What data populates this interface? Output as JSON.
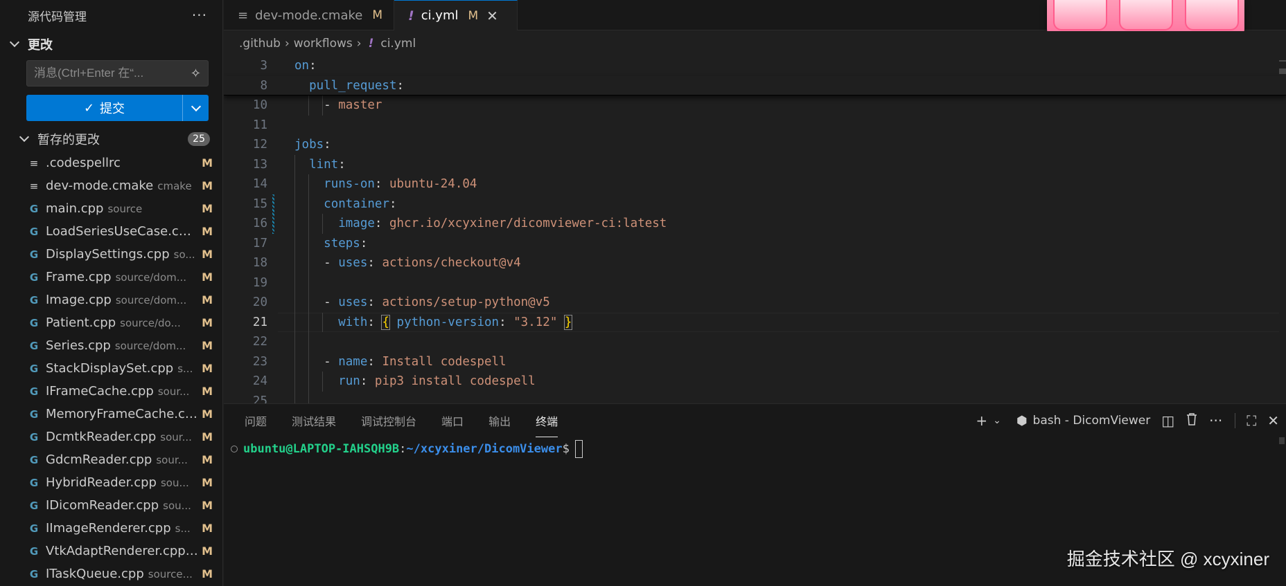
{
  "sidebar": {
    "title": "源代码管理",
    "more": "···",
    "section_title": "更改",
    "message_placeholder": "消息(Ctrl+Enter 在“...",
    "commit_label": "提交",
    "staged_label": "暂存的更改",
    "staged_count": "25",
    "files": [
      {
        "icon": "text-file-icon",
        "glyph": "≡",
        "name": ".codespellrc",
        "path": "",
        "status": "M"
      },
      {
        "icon": "text-file-icon",
        "glyph": "≡",
        "name": "dev-mode.cmake",
        "path": "cmake",
        "status": "M"
      },
      {
        "icon": "cpp-file-icon",
        "glyph": "G",
        "name": "main.cpp",
        "path": "source",
        "status": "M"
      },
      {
        "icon": "cpp-file-icon",
        "glyph": "G",
        "name": "LoadSeriesUseCase.cp...",
        "path": "",
        "status": "M"
      },
      {
        "icon": "cpp-file-icon",
        "glyph": "G",
        "name": "DisplaySettings.cpp",
        "path": "so...",
        "status": "M"
      },
      {
        "icon": "cpp-file-icon",
        "glyph": "G",
        "name": "Frame.cpp",
        "path": "source/dom...",
        "status": "M"
      },
      {
        "icon": "cpp-file-icon",
        "glyph": "G",
        "name": "Image.cpp",
        "path": "source/dom...",
        "status": "M"
      },
      {
        "icon": "cpp-file-icon",
        "glyph": "G",
        "name": "Patient.cpp",
        "path": "source/do...",
        "status": "M"
      },
      {
        "icon": "cpp-file-icon",
        "glyph": "G",
        "name": "Series.cpp",
        "path": "source/dom...",
        "status": "M"
      },
      {
        "icon": "cpp-file-icon",
        "glyph": "G",
        "name": "StackDisplaySet.cpp",
        "path": "s...",
        "status": "M"
      },
      {
        "icon": "cpp-file-icon",
        "glyph": "G",
        "name": "IFrameCache.cpp",
        "path": "sour...",
        "status": "M"
      },
      {
        "icon": "cpp-file-icon",
        "glyph": "G",
        "name": "MemoryFrameCache.c...",
        "path": "",
        "status": "M"
      },
      {
        "icon": "cpp-file-icon",
        "glyph": "G",
        "name": "DcmtkReader.cpp",
        "path": "sour...",
        "status": "M"
      },
      {
        "icon": "cpp-file-icon",
        "glyph": "G",
        "name": "GdcmReader.cpp",
        "path": "sour...",
        "status": "M"
      },
      {
        "icon": "cpp-file-icon",
        "glyph": "G",
        "name": "HybridReader.cpp",
        "path": "sou...",
        "status": "M"
      },
      {
        "icon": "cpp-file-icon",
        "glyph": "G",
        "name": "IDicomReader.cpp",
        "path": "sou...",
        "status": "M"
      },
      {
        "icon": "cpp-file-icon",
        "glyph": "G",
        "name": "IImageRenderer.cpp",
        "path": "s...",
        "status": "M"
      },
      {
        "icon": "cpp-file-icon",
        "glyph": "G",
        "name": "VtkAdaptRenderer.cpp...",
        "path": "",
        "status": "M"
      },
      {
        "icon": "cpp-file-icon",
        "glyph": "G",
        "name": "ITaskQueue.cpp",
        "path": "source...",
        "status": "M"
      }
    ]
  },
  "tabs": [
    {
      "name": "dev-mode.cmake",
      "status": "M",
      "icon": "≡",
      "active": false
    },
    {
      "name": "ci.yml",
      "status": "M",
      "icon": "!",
      "active": true,
      "close": "✕"
    }
  ],
  "breadcrumb": {
    "parts": [
      ".github",
      "workflows",
      "ci.yml"
    ],
    "sep": "›",
    "file_icon": "!"
  },
  "editor": {
    "lines": [
      {
        "n": "3",
        "tokens": [
          [
            "k",
            "on"
          ],
          [
            "p",
            ":"
          ]
        ]
      },
      {
        "n": "8",
        "tokens": [
          [
            "p",
            "  "
          ],
          [
            "k",
            "pull_request"
          ],
          [
            "p",
            ":"
          ]
        ]
      },
      {
        "n": "10",
        "tokens": [
          [
            "p",
            "    - "
          ],
          [
            "s",
            "master"
          ]
        ]
      },
      {
        "n": "11",
        "tokens": []
      },
      {
        "n": "12",
        "tokens": [
          [
            "k",
            "jobs"
          ],
          [
            "p",
            ":"
          ]
        ]
      },
      {
        "n": "13",
        "tokens": [
          [
            "p",
            "  "
          ],
          [
            "k",
            "lint"
          ],
          [
            "p",
            ":"
          ]
        ]
      },
      {
        "n": "14",
        "tokens": [
          [
            "p",
            "    "
          ],
          [
            "k",
            "runs-on"
          ],
          [
            "p",
            ": "
          ],
          [
            "s",
            "ubuntu-24.04"
          ]
        ]
      },
      {
        "n": "15",
        "tokens": [
          [
            "p",
            "    "
          ],
          [
            "k",
            "container"
          ],
          [
            "p",
            ":"
          ]
        ]
      },
      {
        "n": "16",
        "tokens": [
          [
            "p",
            "      "
          ],
          [
            "k",
            "image"
          ],
          [
            "p",
            ": "
          ],
          [
            "s",
            "ghcr.io/xcyxiner/dicomviewer-ci:latest"
          ]
        ]
      },
      {
        "n": "17",
        "tokens": [
          [
            "p",
            "    "
          ],
          [
            "k",
            "steps"
          ],
          [
            "p",
            ":"
          ]
        ]
      },
      {
        "n": "18",
        "tokens": [
          [
            "p",
            "    - "
          ],
          [
            "k",
            "uses"
          ],
          [
            "p",
            ": "
          ],
          [
            "s",
            "actions/checkout@v4"
          ]
        ]
      },
      {
        "n": "19",
        "tokens": []
      },
      {
        "n": "20",
        "tokens": [
          [
            "p",
            "    - "
          ],
          [
            "k",
            "uses"
          ],
          [
            "p",
            ": "
          ],
          [
            "s",
            "actions/setup-python@v5"
          ]
        ]
      },
      {
        "n": "21",
        "tokens": [
          [
            "p",
            "      "
          ],
          [
            "k",
            "with"
          ],
          [
            "p",
            ": "
          ],
          [
            "br",
            "{"
          ],
          [
            "p",
            " "
          ],
          [
            "k",
            "python-version"
          ],
          [
            "p",
            ": "
          ],
          [
            "s",
            "\"3.12\""
          ],
          [
            "p",
            " "
          ],
          [
            "br",
            "}"
          ]
        ]
      },
      {
        "n": "22",
        "tokens": []
      },
      {
        "n": "23",
        "tokens": [
          [
            "p",
            "    - "
          ],
          [
            "k",
            "name"
          ],
          [
            "p",
            ": "
          ],
          [
            "s",
            "Install codespell"
          ]
        ]
      },
      {
        "n": "24",
        "tokens": [
          [
            "p",
            "      "
          ],
          [
            "k",
            "run"
          ],
          [
            "p",
            ": "
          ],
          [
            "s",
            "pip3 install codespell"
          ]
        ]
      },
      {
        "n": "25",
        "tokens": []
      }
    ],
    "current_line": "21"
  },
  "panel": {
    "tabs": [
      "问题",
      "测试结果",
      "调试控制台",
      "端口",
      "输出",
      "终端"
    ],
    "active_tab": "终端",
    "terminal_name": "bash - DicomViewer",
    "actions": {
      "add": "+",
      "dropdown": "⌄",
      "split": "◫",
      "trash": "🗑",
      "more": "···",
      "maximize": "⛶",
      "close": "✕"
    },
    "prompt_user": "ubuntu@LAPTOP-IAHSQH9B",
    "prompt_colon": ":",
    "prompt_path": "~/xcyxiner/DicomViewer",
    "prompt_dollar": "$"
  },
  "watermark": "掘金技术社区 @ xcyxiner",
  "colors": {
    "accent": "#0078d4",
    "modified": "#e2c08d",
    "yaml_key": "#569cd6",
    "yaml_string": "#ce9178"
  }
}
